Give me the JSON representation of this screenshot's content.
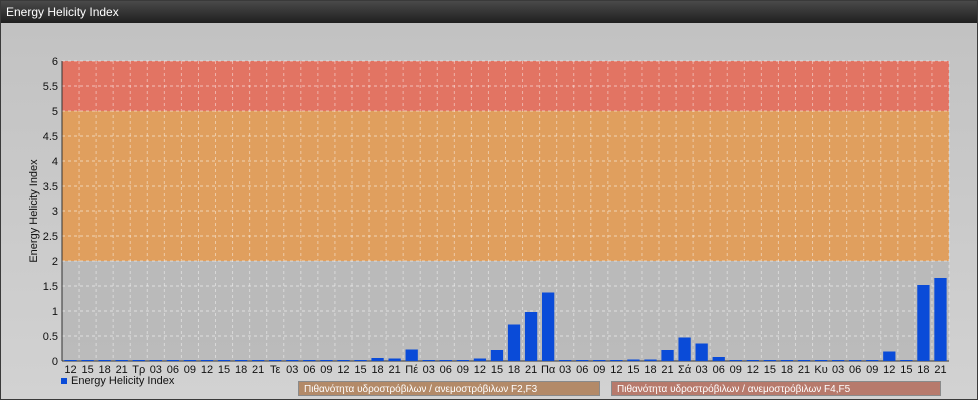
{
  "window": {
    "title": "Energy Helicity Index"
  },
  "colors": {
    "bar": "#0a4bd8",
    "zone_low": "#b9b9b9",
    "zone_mid": "#e29b55",
    "zone_high": "#e46d5a"
  },
  "legend": {
    "series_label": "Energy Helicity Index",
    "zone1_label": "Πιθανότητα υδροστρόβιλων / ανεμοστρόβιλων F2,F3",
    "zone2_label": "Πιθανότητα υδροστρόβιλων / ανεμοστρόβιλων F4,F5"
  },
  "chart_data": {
    "type": "bar",
    "title": "Energy Helicity Index",
    "xlabel": "",
    "ylabel": "Energy Helicity Index",
    "ylim": [
      0,
      6
    ],
    "yticks": [
      "0",
      "0.5",
      "1",
      "1.5",
      "2",
      "2.5",
      "3",
      "3.5",
      "4",
      "4.5",
      "5",
      "5.5",
      "6"
    ],
    "grid": true,
    "legend_position": "bottom-left",
    "zones": [
      {
        "from": 0,
        "to": 2,
        "color": "#b9b9b9"
      },
      {
        "from": 2,
        "to": 5,
        "color": "#e29b55"
      },
      {
        "from": 5,
        "to": 6,
        "color": "#e46d5a"
      }
    ],
    "categories": [
      "12",
      "15",
      "18",
      "21",
      "Τρ",
      "03",
      "06",
      "09",
      "12",
      "15",
      "18",
      "21",
      "Τε",
      "03",
      "06",
      "09",
      "12",
      "15",
      "18",
      "21",
      "Πέ",
      "03",
      "06",
      "09",
      "12",
      "15",
      "18",
      "21",
      "Πα",
      "03",
      "06",
      "09",
      "12",
      "15",
      "18",
      "21",
      "Σά",
      "03",
      "06",
      "09",
      "12",
      "15",
      "18",
      "21",
      "Κυ",
      "03",
      "06",
      "09",
      "12",
      "15",
      "18",
      "21"
    ],
    "series": [
      {
        "name": "Energy Helicity Index",
        "values": [
          0.02,
          0.02,
          0.02,
          0.02,
          0.02,
          0.02,
          0.02,
          0.02,
          0.02,
          0.02,
          0.02,
          0.02,
          0.02,
          0.02,
          0.02,
          0.02,
          0.02,
          0.02,
          0.06,
          0.05,
          0.23,
          0.02,
          0.02,
          0.02,
          0.05,
          0.22,
          0.73,
          0.98,
          1.37,
          0.02,
          0.02,
          0.02,
          0.02,
          0.03,
          0.03,
          0.22,
          0.47,
          0.35,
          0.08,
          0.02,
          0.02,
          0.02,
          0.02,
          0.02,
          0.02,
          0.02,
          0.02,
          0.02,
          0.19,
          0.02,
          1.52,
          1.66
        ]
      }
    ]
  }
}
